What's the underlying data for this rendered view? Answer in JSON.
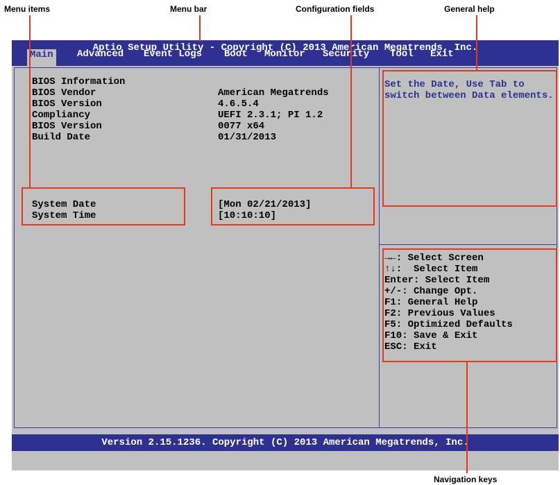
{
  "callouts": {
    "menu_items": "Menu items",
    "menu_bar": "Menu bar",
    "configuration_fields": "Configuration fields",
    "general_help": "General help",
    "navigation_keys": "Navigation keys"
  },
  "header": {
    "title": "Aptio Setup Utility - Copyright (C) 2013 American Megatrends, Inc."
  },
  "menu": [
    {
      "label": "Main",
      "active": true
    },
    {
      "label": "Advanced"
    },
    {
      "label": "Event Logs"
    },
    {
      "label": "Boot"
    },
    {
      "label": "Monitor"
    },
    {
      "label": "Security"
    },
    {
      "label": "Tool"
    },
    {
      "label": "Exit"
    }
  ],
  "info": {
    "heading": "BIOS Information",
    "rows": [
      {
        "label": "BIOS Vendor",
        "value": "American Megatrends"
      },
      {
        "label": "BIOS Version",
        "value": "4.6.5.4"
      },
      {
        "label": "Compliancy",
        "value": "UEFI 2.3.1; PI 1.2"
      },
      {
        "label": "BIOS Version",
        "value": "0077 x64"
      },
      {
        "label": "Build Date",
        "value": "01/31/2013"
      }
    ]
  },
  "config": [
    {
      "label": "System Date",
      "value": "[Mon 02/21/2013]"
    },
    {
      "label": "System Time",
      "value": "[10:10:10]"
    }
  ],
  "help": {
    "lines": [
      "Set the Date, Use Tab to",
      "switch between Data elements."
    ]
  },
  "nav_keys": [
    "→←: Select Screen",
    "↑↓:  Select Item",
    "Enter: Select Item",
    "+/-: Change Opt.",
    "F1: General Help",
    "F2: Previous Values",
    "F5: Optimized Defaults",
    "F10: Save & Exit",
    "ESC: Exit"
  ],
  "footer": {
    "text": "Version 2.15.1236. Copyright (C) 2013 American Megatrends, Inc."
  },
  "colors": {
    "bios_bg": "#c0c0c0",
    "bar_blue": "#2e3192",
    "callout_red": "#e23a1f"
  }
}
